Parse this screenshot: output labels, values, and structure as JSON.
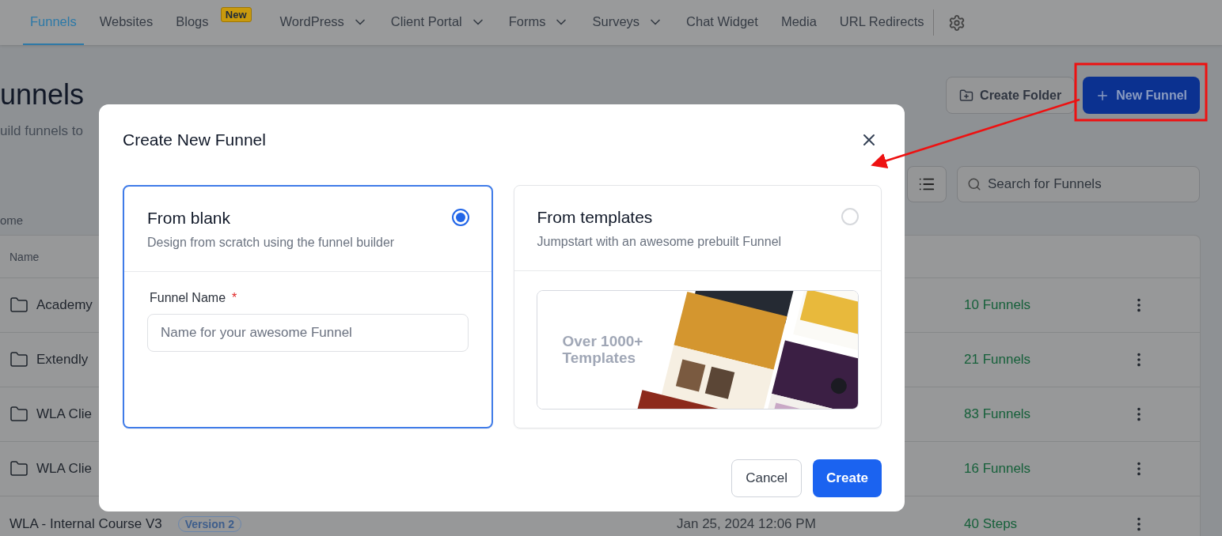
{
  "top_nav": {
    "items": [
      {
        "label": "Funnels",
        "selected": true,
        "dropdown": false
      },
      {
        "label": "Websites",
        "selected": false,
        "dropdown": false
      },
      {
        "label": "Blogs",
        "selected": false,
        "dropdown": false,
        "badge": "New"
      },
      {
        "label": "WordPress",
        "selected": false,
        "dropdown": true
      },
      {
        "label": "Client Portal",
        "selected": false,
        "dropdown": true
      },
      {
        "label": "Forms",
        "selected": false,
        "dropdown": true
      },
      {
        "label": "Surveys",
        "selected": false,
        "dropdown": true
      },
      {
        "label": "Chat Widget",
        "selected": false,
        "dropdown": false
      },
      {
        "label": "Media",
        "selected": false,
        "dropdown": false
      },
      {
        "label": "URL Redirects",
        "selected": false,
        "dropdown": false
      }
    ]
  },
  "page": {
    "title": "unnels",
    "subtitle": "uild funnels to",
    "breadcrumb": "ome",
    "actions": [
      {
        "label": "Create Folder",
        "kind": "secondary"
      },
      {
        "label": "New Funnel",
        "kind": "primary"
      }
    ],
    "search": {
      "placeholder": "Search for Funnels"
    }
  },
  "table": {
    "columns": [
      "Name"
    ],
    "rows": [
      {
        "kind": "folder",
        "name": "Academy",
        "count": "10 Funnels"
      },
      {
        "kind": "folder",
        "name": "Extendly",
        "count": "21 Funnels"
      },
      {
        "kind": "folder",
        "name": "WLA Clie",
        "count": "83 Funnels"
      },
      {
        "kind": "folder",
        "name": "WLA Clie",
        "count": "16 Funnels"
      },
      {
        "kind": "funnel",
        "name": "WLA - Internal Course V3",
        "tag": "Version 2",
        "date": "Jan 25, 2024 12:06 PM",
        "count": "40 Steps"
      }
    ]
  },
  "modal": {
    "title": "Create New Funnel",
    "options": [
      {
        "kind": "form",
        "title": "From blank",
        "description": "Design from scratch using the funnel builder",
        "selected": true,
        "field": {
          "label": "Funnel Name",
          "required_mark": "*",
          "placeholder": "Name for your awesome Funnel"
        }
      },
      {
        "kind": "preview",
        "title": "From templates",
        "description": "Jumpstart with an awesome prebuilt Funnel",
        "selected": false,
        "preview_text": "Over 1000+ Templates"
      }
    ],
    "buttons": [
      {
        "label": "Cancel",
        "kind": "secondary"
      },
      {
        "label": "Create",
        "kind": "primary"
      }
    ]
  }
}
